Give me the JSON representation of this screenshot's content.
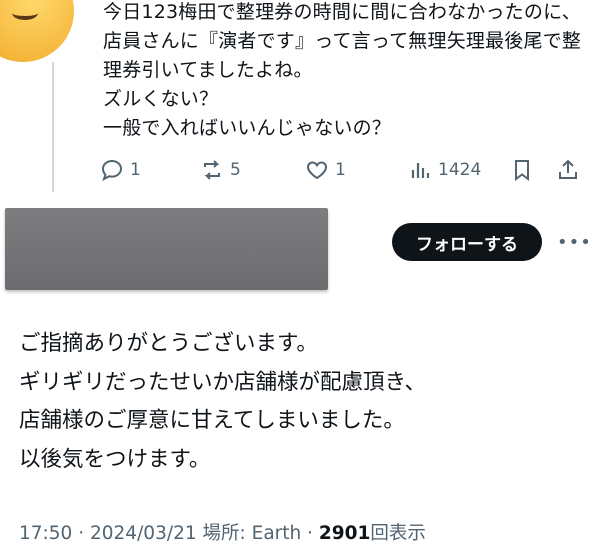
{
  "reply_tweet": {
    "text": "今日123梅田で整理券の時間に間に合わなかったのに、店員さんに『演者です』って言って無理矢理最後尾で整理券引いてましたよね。\nズルくない？\n一般で入ればいいんじゃないの？",
    "actions": {
      "replies": "1",
      "retweets": "5",
      "likes": "1",
      "views": "1424"
    }
  },
  "author": {
    "follow_label": "フォローする",
    "more_label": "•••"
  },
  "main_tweet": {
    "text": "ご指摘ありがとうございます。\nギリギリだったせいか店舗様が配慮頂き、\n店舗様のご厚意に甘えてしまいました。\n以後気をつけます。",
    "time": "17:50",
    "date": "2024/03/21",
    "location_label": "場所: Earth",
    "views_count": "2901",
    "views_suffix": "回表示"
  },
  "icons": [
    "avatar-emoji",
    "reply-icon",
    "retweet-icon",
    "like-icon",
    "views-icon",
    "bookmark-icon",
    "share-icon"
  ],
  "colors": {
    "text": "#0f1419",
    "muted": "#536471",
    "button_bg": "#0f1419"
  }
}
